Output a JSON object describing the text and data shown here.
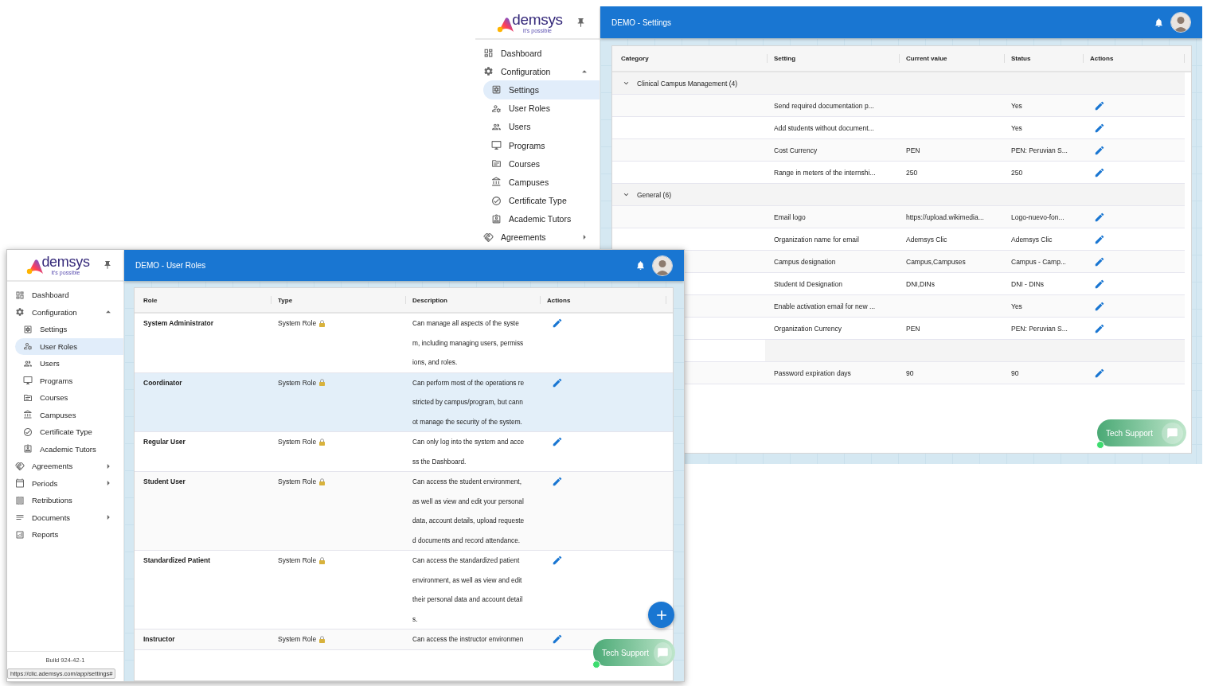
{
  "settings_window": {
    "logo": {
      "wordmark": "demsys",
      "tagline": "it's possible"
    },
    "sidebar": {
      "items": [
        {
          "kind": "link",
          "label": "Dashboard",
          "selected": false
        },
        {
          "kind": "group",
          "label": "Configuration",
          "expanded": true,
          "selected": false,
          "children": [
            {
              "label": "Settings",
              "selected": true
            },
            {
              "label": "User Roles",
              "selected": false
            },
            {
              "label": "Users",
              "selected": false
            },
            {
              "label": "Programs",
              "selected": false
            },
            {
              "label": "Courses",
              "selected": false
            },
            {
              "label": "Campuses",
              "selected": false
            },
            {
              "label": "Certificate Type",
              "selected": false
            },
            {
              "label": "Academic Tutors",
              "selected": false
            }
          ]
        },
        {
          "kind": "group",
          "label": "Agreements",
          "expanded": false,
          "selected": false
        }
      ]
    },
    "header": {
      "title": "DEMO - Settings"
    },
    "table": {
      "columns": [
        "Category",
        "Setting",
        "Current value",
        "Status",
        "Actions"
      ],
      "groups": [
        {
          "label": "Clinical Campus Management (4)",
          "expanded": true,
          "rows": [
            {
              "setting": "Send required documentation p...",
              "status": "Yes"
            },
            {
              "setting": "Add students without document...",
              "status": "Yes"
            },
            {
              "setting": "Cost Currency",
              "current_value": "PEN",
              "status": "PEN: Peruvian S..."
            },
            {
              "setting": "Range in meters of the internshi...",
              "current_value": "250",
              "status": "250"
            }
          ]
        },
        {
          "label": "General (6)",
          "expanded": true,
          "rows": [
            {
              "setting": "Email logo",
              "current_value": "https://upload.wikimedia...",
              "status": "Logo-nuevo-fon..."
            },
            {
              "setting": "Organization name for email",
              "current_value": "Ademsys Clic",
              "status": "Ademsys Clic"
            },
            {
              "setting": "Campus designation",
              "current_value": "Campus,Campuses",
              "status": "Campus - Camp..."
            },
            {
              "setting": "Student Id Designation",
              "current_value": "DNI,DINs",
              "status": "DNI - DINs"
            },
            {
              "setting": "Enable activation email for new ...",
              "status": "Yes"
            },
            {
              "setting": "Organization Currency",
              "current_value": "PEN",
              "status": "PEN: Peruvian S..."
            }
          ]
        },
        {
          "rows": [
            {
              "setting": "Password expiration days",
              "current_value": "90",
              "status": "90"
            }
          ]
        }
      ]
    },
    "support_button": {
      "label": "Tech Support"
    }
  },
  "roles_window": {
    "logo": {
      "wordmark": "demsys",
      "tagline": "it's possible"
    },
    "sidebar": {
      "items": [
        {
          "kind": "link",
          "label": "Dashboard",
          "selected": false
        },
        {
          "kind": "group",
          "label": "Configuration",
          "expanded": true,
          "selected": false,
          "children": [
            {
              "label": "Settings",
              "selected": false
            },
            {
              "label": "User Roles",
              "selected": true
            },
            {
              "label": "Users",
              "selected": false
            },
            {
              "label": "Programs",
              "selected": false
            },
            {
              "label": "Courses",
              "selected": false
            },
            {
              "label": "Campuses",
              "selected": false
            },
            {
              "label": "Certificate Type",
              "selected": false
            },
            {
              "label": "Academic Tutors",
              "selected": false
            }
          ]
        },
        {
          "kind": "group",
          "label": "Agreements",
          "expanded": false,
          "selected": false
        },
        {
          "kind": "group",
          "label": "Periods",
          "expanded": false,
          "selected": false
        },
        {
          "kind": "link",
          "label": "Retributions",
          "selected": false
        },
        {
          "kind": "group",
          "label": "Documents",
          "expanded": false,
          "selected": false
        },
        {
          "kind": "link",
          "label": "Reports",
          "selected": false
        }
      ]
    },
    "build": "Build 924-42-1",
    "status_url": "https://clic.ademsys.com/app/settings#",
    "header": {
      "title": "DEMO - User Roles"
    },
    "table": {
      "columns": [
        "Role",
        "Type",
        "Description",
        "Actions"
      ],
      "rows": [
        {
          "role": "System Administrator",
          "type": "System Role",
          "description": "Can manage all aspects of the system, including managing users, permissions, and roles.",
          "selected": false
        },
        {
          "role": "Coordinator",
          "type": "System Role",
          "description": "Can perform most of the operations restricted by campus/program, but cannot manage the security of the system.",
          "selected": true
        },
        {
          "role": "Regular User",
          "type": "System Role",
          "description": "Can only log into the system and access the Dashboard.",
          "selected": false
        },
        {
          "role": "Student User",
          "type": "System Role",
          "description": "Can access the student environment, as well as view and edit your personal data, account details, upload requested documents and record attendance.",
          "selected": false
        },
        {
          "role": "Standardized Patient",
          "type": "System Role",
          "description": "Can access the standardized patient environment, as well as view and edit their personal data and account details.",
          "selected": false
        },
        {
          "role": "Instructor",
          "type": "System Role",
          "description": "Can access the instructor environmen",
          "selected": false
        }
      ]
    },
    "support_button": {
      "label": "Tech Support"
    }
  }
}
